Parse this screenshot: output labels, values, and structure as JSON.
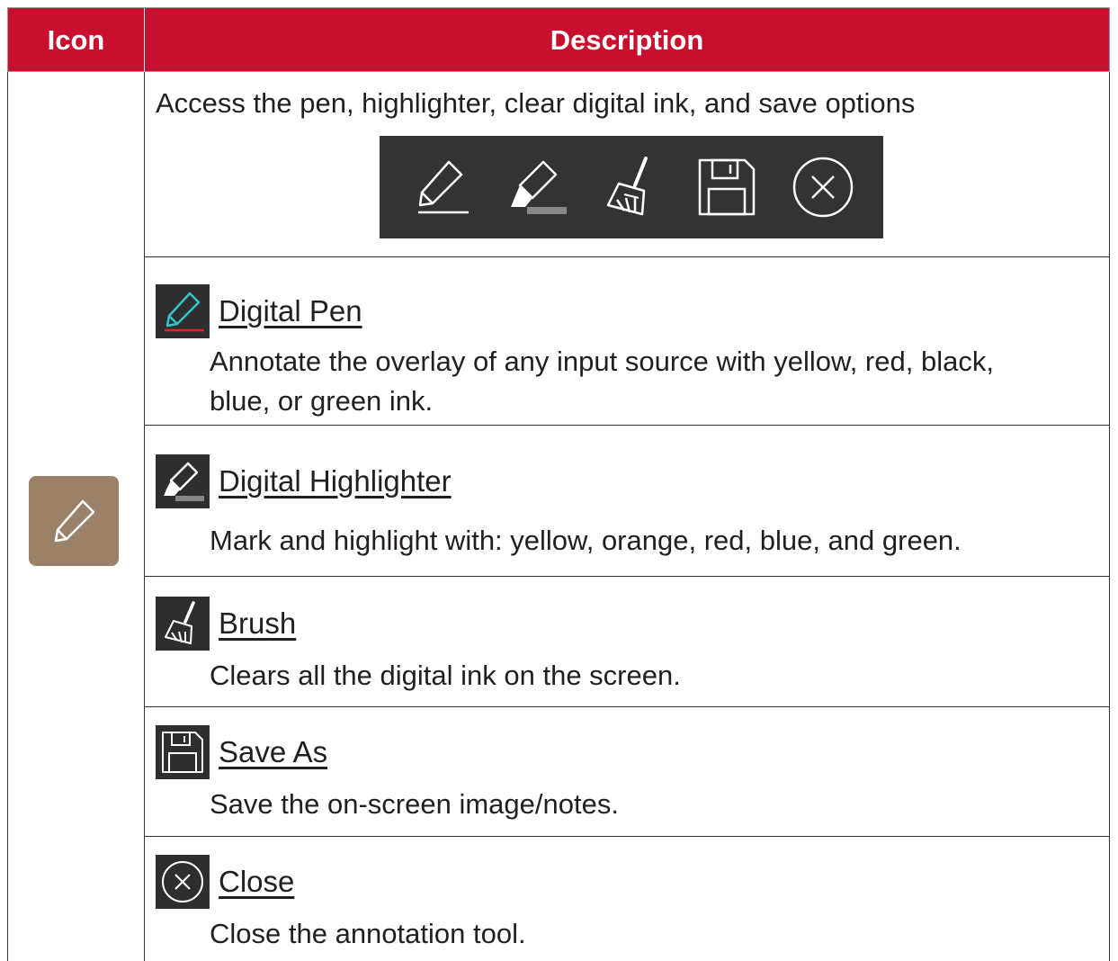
{
  "header": {
    "icon_label": "Icon",
    "description_label": "Description"
  },
  "main_icon": {
    "name": "pen-icon",
    "bg_color": "#9a8167"
  },
  "intro": {
    "text": "Access the pen, highlighter, clear digital ink, and save options",
    "toolbar_icons": [
      "pen-icon",
      "highlighter-icon",
      "brush-icon",
      "save-icon",
      "close-circle-icon"
    ]
  },
  "items": [
    {
      "icon": "digital-pen-icon",
      "title": "Digital Pen",
      "desc_line1": "Annotate the overlay of any input source with yellow, red, black,",
      "desc_line2": "blue, or green ink."
    },
    {
      "icon": "highlighter-icon",
      "title": "Digital Highlighter",
      "desc_line1": "Mark and highlight with: yellow, orange, red, blue, and green.",
      "desc_line2": ""
    },
    {
      "icon": "brush-icon",
      "title": "Brush",
      "desc_line1": "Clears all the digital ink on the screen.",
      "desc_line2": ""
    },
    {
      "icon": "save-icon",
      "title": "Save As",
      "desc_line1": "Save the on-screen image/notes.",
      "desc_line2": ""
    },
    {
      "icon": "close-circle-icon",
      "title": "Close",
      "desc_line1": "Close the annotation tool.",
      "desc_line2": ""
    }
  ],
  "colors": {
    "header_bg": "#c8102e",
    "toolbar_bg": "#333333",
    "pen_accent": "#35c5c8",
    "pen_line": "#e0242b"
  }
}
